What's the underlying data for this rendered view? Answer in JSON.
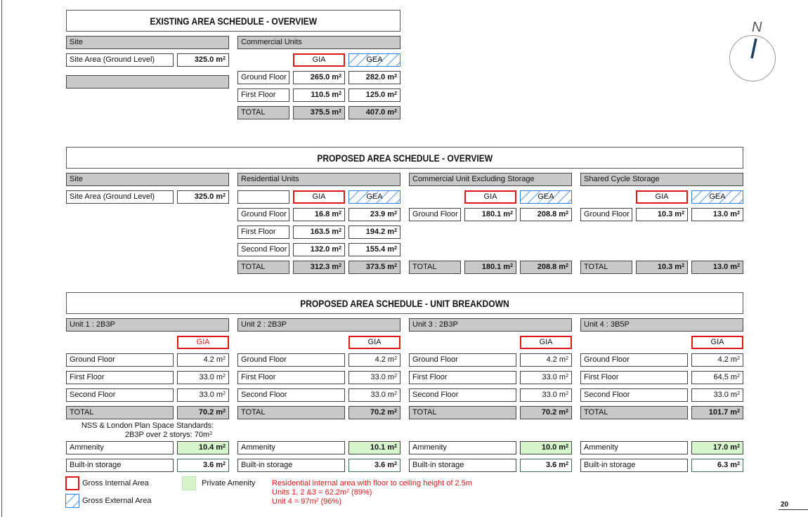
{
  "unit": "m",
  "existing": {
    "title": "EXISTING AREA SCHEDULE - OVERVIEW",
    "site_header": "Site",
    "site_area_label": "Site Area (Ground Level)",
    "site_area_value": "325.0 m",
    "commercial_header": "Commercial Units",
    "gia": "GIA",
    "gea": "GEA",
    "rows": [
      {
        "label": "Ground Floor",
        "gia": "265.0 m",
        "gea": "282.0 m"
      },
      {
        "label": "First Floor",
        "gia": "110.5 m",
        "gea": "125.0 m"
      },
      {
        "label": "TOTAL",
        "gia": "375.5 m",
        "gea": "407.0 m"
      }
    ]
  },
  "proposed": {
    "title": "PROPOSED AREA SCHEDULE - OVERVIEW",
    "site_header": "Site",
    "site_area_label": "Site Area (Ground Level)",
    "site_area_value": "325.0 m",
    "residential": {
      "header": "Residential Units",
      "rows": [
        {
          "label": "Ground Floor",
          "gia": "16.8 m",
          "gea": "23.9 m"
        },
        {
          "label": "First Floor",
          "gia": "163.5 m",
          "gea": "194.2 m"
        },
        {
          "label": "Second Floor",
          "gia": "132.0 m",
          "gea": "155.4 m"
        }
      ],
      "total": {
        "label": "TOTAL",
        "gia": "312.3 m",
        "gea": "373.5 m"
      }
    },
    "commercial": {
      "header": "Commercial Unit  Excluding Storage",
      "row": {
        "label": "Ground Floor",
        "gia": "180.1 m",
        "gea": "208.8 m"
      },
      "total": {
        "label": "TOTAL",
        "gia": "180.1 m",
        "gea": "208.8 m"
      }
    },
    "cycle": {
      "header": "Shared Cycle Storage",
      "row": {
        "label": "Ground Floor",
        "gia": "10.3 m",
        "gea": "13.0 m"
      },
      "total": {
        "label": "TOTAL",
        "gia": "10.3 m",
        "gea": "13.0 m"
      }
    },
    "gia": "GIA",
    "gea": "GEA"
  },
  "breakdown": {
    "title": "PROPOSED AREA SCHEDULE - UNIT BREAKDOWN",
    "gia": "GIA",
    "units": [
      {
        "name": "Unit 1 : 2B3P",
        "ground": "4.2 m",
        "first": "33.0 m",
        "second": "33.0 m",
        "total": "70.2 m",
        "amenity": "10.4 m",
        "storage": "3.6 m"
      },
      {
        "name": "Unit 2 : 2B3P",
        "ground": "4.2 m",
        "first": "33.0 m",
        "second": "33.0 m",
        "total": "70.2 m",
        "amenity": "10.1 m",
        "storage": "3.6 m"
      },
      {
        "name": "Unit 3 : 2B3P",
        "ground": "4.2 m",
        "first": "33.0 m",
        "second": "33.0 m",
        "total": "70.2 m",
        "amenity": "10.0 m",
        "storage": "3.6 m"
      },
      {
        "name": "Unit 4 : 3B5P",
        "ground": "4.2 m",
        "first": "64.5 m",
        "second": "33.0 m",
        "total": "101.7 m",
        "amenity": "17.0 m",
        "storage": "6.3 m"
      }
    ],
    "labels": {
      "ground": "Ground Floor",
      "first": "First Floor",
      "second": "Second Floor",
      "total": "TOTAL",
      "amenity": "Ammenity",
      "storage": "Built-in storage"
    },
    "nss_line1": "NSS & London Plan Space Standards:",
    "nss_line2": "2B3P over 2 storys:  70m"
  },
  "legend": {
    "gia": "Gross Internal Area",
    "gea": "Gross External Area",
    "amenity": "Private Amenity",
    "note1": "Residential internal area with floor to ceiling height of 2.5m",
    "note2a": "Units 1, 2 &3 = 62.2m",
    "note2b": " (89%)",
    "note3a": "Unit 4 = 97m",
    "note3b": "  (96%)"
  },
  "north": "N",
  "page_number": "20",
  "colors": {
    "gia_border": "#e01616",
    "gea_hatch": "#2f7fd8",
    "amenity_fill": "#d6f5cc",
    "header_fill": "#c8c8c8",
    "north_arrow": "#1d3d5c"
  }
}
